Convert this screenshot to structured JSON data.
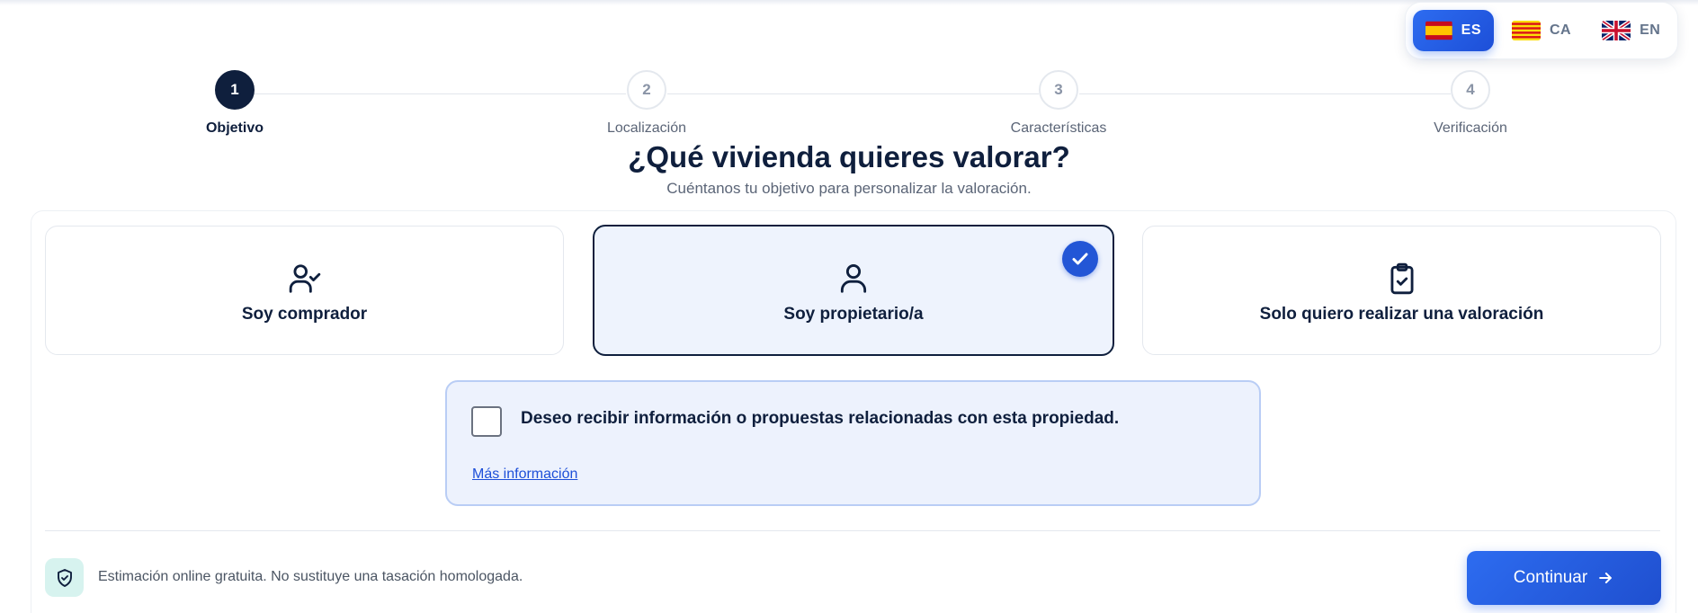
{
  "languages": [
    {
      "code": "ES",
      "flag_icon": "spain-flag-icon",
      "active": true
    },
    {
      "code": "CA",
      "flag_icon": "catalonia-flag-icon",
      "active": false
    },
    {
      "code": "EN",
      "flag_icon": "uk-flag-icon",
      "active": false
    }
  ],
  "stepper": {
    "steps": [
      {
        "number": "1",
        "label": "Objetivo",
        "active": true
      },
      {
        "number": "2",
        "label": "Localización",
        "active": false
      },
      {
        "number": "3",
        "label": "Características",
        "active": false
      },
      {
        "number": "4",
        "label": "Verificación",
        "active": false
      }
    ]
  },
  "heading": {
    "title": "¿Qué vivienda quieres valorar?",
    "subtitle": "Cuéntanos tu objetivo para personalizar la valoración."
  },
  "options": [
    {
      "label": "Soy comprador",
      "icon": "user-check-icon",
      "selected": false
    },
    {
      "label": "Soy propietario/a",
      "icon": "user-icon",
      "selected": true
    },
    {
      "label": "Solo quiero realizar una valoración",
      "icon": "clipboard-check-icon",
      "selected": false
    }
  ],
  "consent": {
    "text": "Deseo recibir información o propuestas relacionadas con esta propiedad.",
    "checked": false,
    "link": "Más información"
  },
  "footer": {
    "note_icon": "shield-check-icon",
    "note": "Estimación online gratuita. No sustituye una tasación homologada.",
    "continue_label": "Continuar",
    "continue_icon": "arrow-right-icon"
  },
  "colors": {
    "primary": "#2356d6",
    "navy": "#0f1f3d",
    "selected_bg": "#eef3fd",
    "consent_bg": "#edf2fd",
    "note_icon_bg": "#d7f3ef"
  }
}
